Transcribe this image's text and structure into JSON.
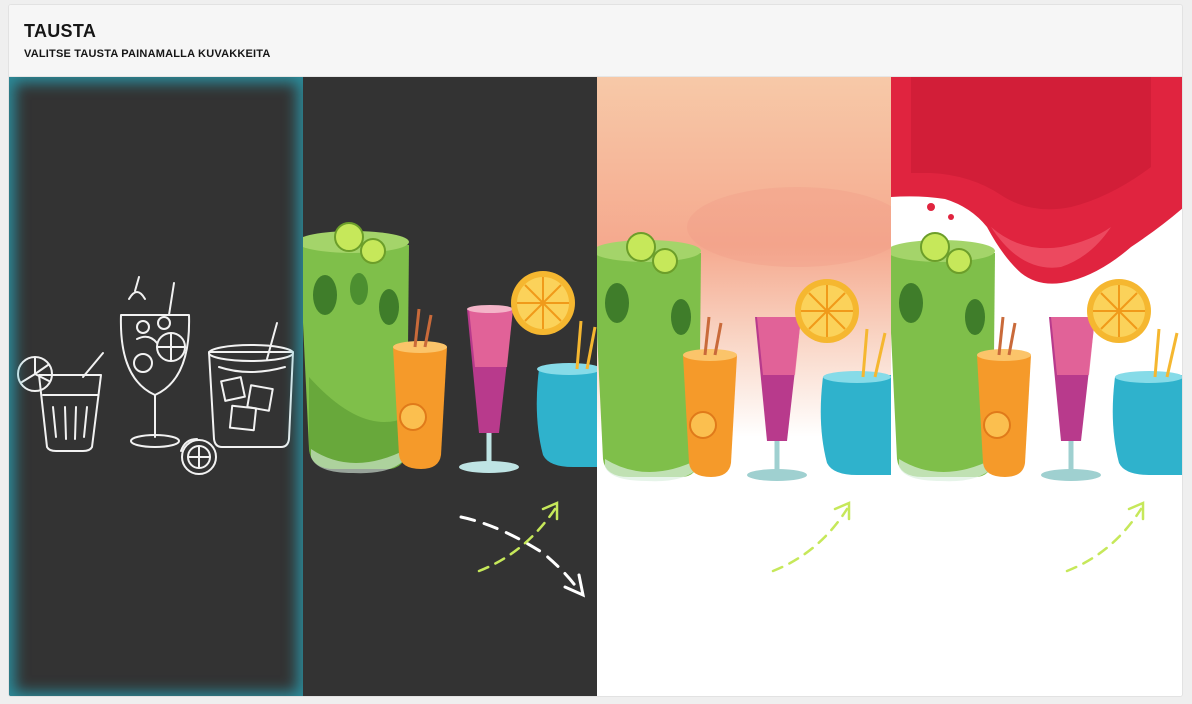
{
  "header": {
    "title": "TAUSTA",
    "subtitle": "VALITSE TAUSTA PAINAMALLA KUVAKKEITA"
  },
  "backgrounds": [
    {
      "style": "chalk-sketch",
      "base_color": "#333333",
      "selected": true
    },
    {
      "style": "watercolor-on-dark",
      "base_color": "#333333",
      "selected": false
    },
    {
      "style": "watercolor-peach",
      "base_color": "#f6b08f",
      "selected": false
    },
    {
      "style": "watercolor-red-splash",
      "base_color": "#e0243f",
      "selected": false
    }
  ],
  "colors": {
    "selection_glow": "#2aaabe",
    "dark_bg": "#333333",
    "lime_arrow": "#c6e85a"
  }
}
